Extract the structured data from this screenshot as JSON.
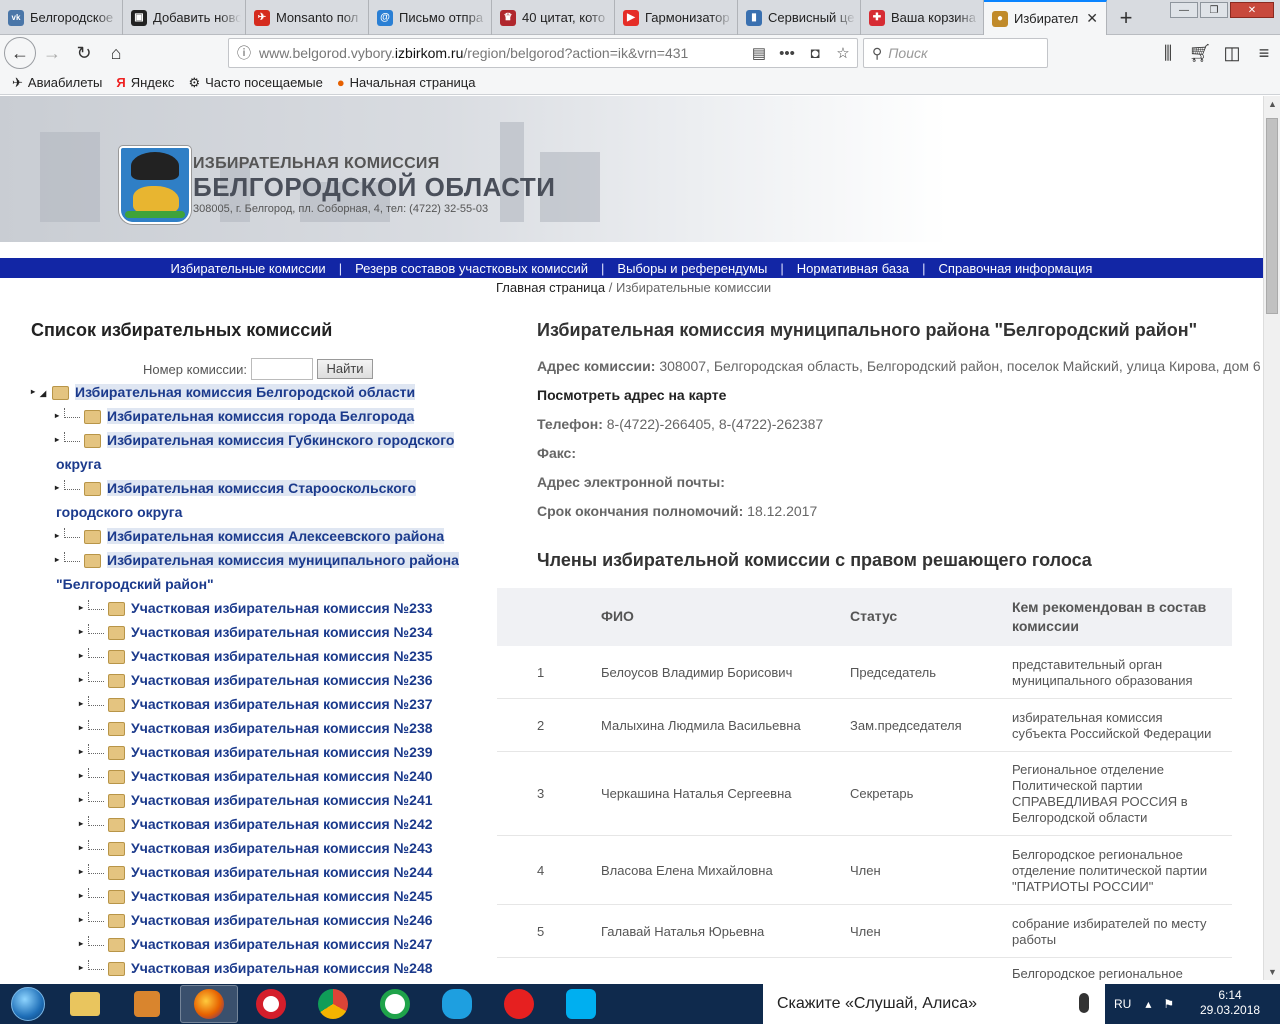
{
  "tabs": [
    {
      "label": "Белгородское",
      "color": "#4a76a8",
      "glyph": "vk"
    },
    {
      "label": "Добавить ново",
      "color": "#222222",
      "glyph": "▣"
    },
    {
      "label": "Monsanto пол",
      "color": "#d52b1e",
      "glyph": "✈"
    },
    {
      "label": "Письмо отпра",
      "color": "#2a7fd4",
      "glyph": "@"
    },
    {
      "label": "40 цитат, кото",
      "color": "#b0272d",
      "glyph": "♛"
    },
    {
      "label": "Гармонизатор",
      "color": "#e52d27",
      "glyph": "▶"
    },
    {
      "label": "Сервисный це",
      "color": "#3a70b0",
      "glyph": "▮"
    },
    {
      "label": "Ваша корзина",
      "color": "#d62b33",
      "glyph": "✚"
    },
    {
      "label": "Избирател",
      "color": "#c08a2a",
      "glyph": "●"
    }
  ],
  "url": {
    "pre": "www.belgorod.vybory.",
    "host": "izbirkom.ru",
    "post": "/region/belgorod?action=ik&vrn=431"
  },
  "search_placeholder": "Поиск",
  "bookmarks": [
    "Авиабилеты",
    "Яндекс",
    "Часто посещаемые",
    "Начальная страница"
  ],
  "banner": {
    "line1": "ИЗБИРАТЕЛЬНАЯ КОМИССИЯ",
    "line2": "БЕЛГОРОДСКОЙ ОБЛАСТИ",
    "line3": "308005, г. Белгород, пл. Соборная, 4, тел: (4722) 32-55-03"
  },
  "menu": [
    "Избирательные комиссии",
    "Резерв составов участковых комиссий",
    "Выборы и референдумы",
    "Нормативная база",
    "Справочная информация"
  ],
  "menu_sep": "|",
  "breadcrumb": {
    "home": "Главная страница",
    "sep": " / ",
    "current": "Избирательные комиссии"
  },
  "left": {
    "title": "Список избирательных комиссий",
    "number_label": "Номер комиссии:",
    "find_button": "Найти",
    "root": "Избирательная комиссия Белгородской области",
    "level1": [
      {
        "line1": "Избирательная комиссия города Белгорода",
        "line2": ""
      },
      {
        "line1": "Избирательная комиссия Губкинского городского",
        "line2": "округа"
      },
      {
        "line1": "Избирательная комиссия Старооскольского",
        "line2": "городского округа"
      },
      {
        "line1": "Избирательная комиссия Алексеевского района",
        "line2": ""
      },
      {
        "line1": "Избирательная комиссия муниципального района",
        "line2": "\"Белгородский район\""
      }
    ],
    "uiks": [
      "Участковая избирательная комиссия №233",
      "Участковая избирательная комиссия №234",
      "Участковая избирательная комиссия №235",
      "Участковая избирательная комиссия №236",
      "Участковая избирательная комиссия №237",
      "Участковая избирательная комиссия №238",
      "Участковая избирательная комиссия №239",
      "Участковая избирательная комиссия №240",
      "Участковая избирательная комиссия №241",
      "Участковая избирательная комиссия №242",
      "Участковая избирательная комиссия №243",
      "Участковая избирательная комиссия №244",
      "Участковая избирательная комиссия №245",
      "Участковая избирательная комиссия №246",
      "Участковая избирательная комиссия №247",
      "Участковая избирательная комиссия №248"
    ]
  },
  "right": {
    "title": "Избирательная комиссия муниципального района \"Белгородский район\"",
    "address_label": "Адрес комиссии:",
    "address": "308007, Белгородская область, Белгородский район, поселок Майский, улица Кирова, дом 6",
    "map_link": "Посмотреть адрес на карте",
    "phone_label": "Телефон:",
    "phone": "8-(4722)-266405, 8-(4722)-262387",
    "fax_label": "Факс:",
    "email_label": "Адрес электронной почты:",
    "term_label": "Срок окончания полномочий:",
    "term": "18.12.2017",
    "members_title": "Члены избирательной комиссии с правом решающего голоса",
    "columns": [
      "ФИО",
      "Статус",
      "Кем рекомендован в состав комиссии"
    ],
    "members": [
      {
        "n": "1",
        "name": "Белоусов Владимир Борисович",
        "status": "Председатель",
        "rec": "представительный орган муниципального образования"
      },
      {
        "n": "2",
        "name": "Малыхина Людмила Васильевна",
        "status": "Зам.председателя",
        "rec": "избирательная комиссия субъекта Российской Федерации"
      },
      {
        "n": "3",
        "name": "Черкашина Наталья Сергеевна",
        "status": "Секретарь",
        "rec": "Региональное отделение Политической партии СПРАВЕДЛИВАЯ РОССИЯ в Белгородской области"
      },
      {
        "n": "4",
        "name": "Власова Елена Михайловна",
        "status": "Член",
        "rec": "Белгородское региональное отделение политической партии \"ПАТРИОТЫ РОССИИ\""
      },
      {
        "n": "5",
        "name": "Галавай Наталья Юрьевна",
        "status": "Член",
        "rec": "собрание избирателей по месту работы"
      }
    ],
    "partial_row": "Белгородское региональное"
  },
  "taskbar": {
    "alice": "Скажите «Слушай, Алиса»",
    "lang": "RU",
    "time": "6:14",
    "date": "29.03.2018"
  }
}
